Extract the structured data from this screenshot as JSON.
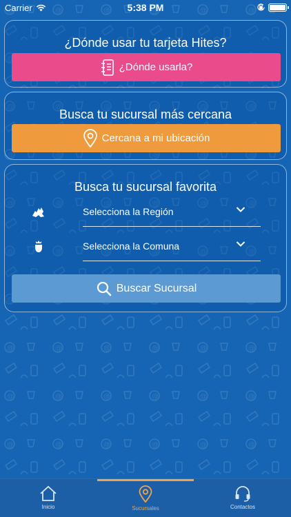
{
  "status_bar": {
    "carrier": "Carrier",
    "time": "5:38 PM",
    "battery_level": 1.0
  },
  "card_where": {
    "title": "¿Dónde usar tu tarjeta Hites?",
    "button_label": "¿Dónde usarla?",
    "button_icon": "notebook-icon",
    "button_color": "#ea4b8a"
  },
  "card_nearest": {
    "title": "Busca tu sucursal más cercana",
    "button_label": "Cercana a mi ubicación",
    "button_icon": "location-pin-icon",
    "button_color": "#f09a3e"
  },
  "card_favorite": {
    "title": "Busca tu sucursal favorita",
    "region_placeholder": "Selecciona la Región",
    "region_icon": "region-map-icon",
    "comuna_placeholder": "Selecciona la Comuna",
    "comuna_icon": "comuna-emblem-icon",
    "search_button_label": "Buscar Sucursal",
    "search_button_color": "#5b9ad2"
  },
  "tab_bar": {
    "active_tab": "Sucursales",
    "active_color": "#f0a54a",
    "tabs": [
      {
        "label": "Inicio",
        "icon": "home-icon"
      },
      {
        "label": "Sucursales",
        "icon": "location-pin-icon"
      },
      {
        "label": "Contactos",
        "icon": "headset-icon"
      }
    ]
  },
  "theme": {
    "background": "#1565b4"
  }
}
